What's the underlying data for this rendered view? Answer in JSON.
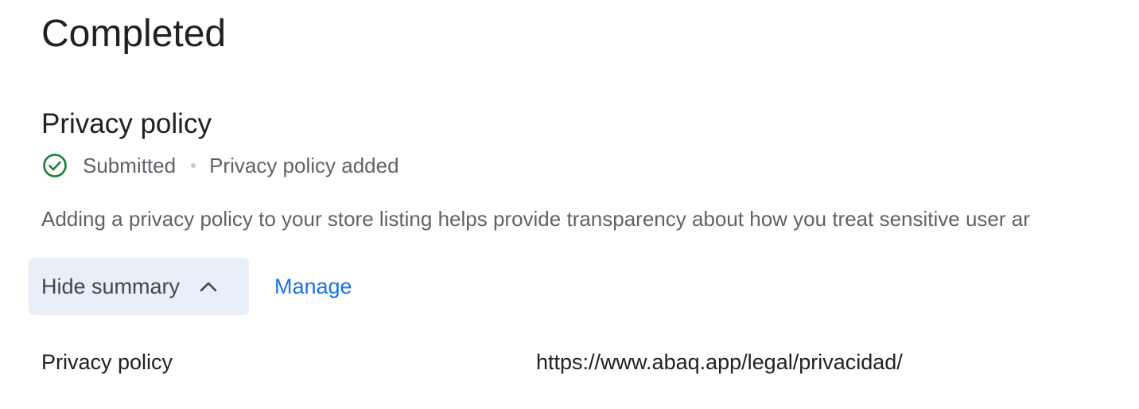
{
  "page": {
    "title": "Completed"
  },
  "section": {
    "title": "Privacy policy",
    "status_icon": "check-circle-icon",
    "status_color": "#188038",
    "status_label": "Submitted",
    "status_detail": "Privacy policy added",
    "description": "Adding a privacy policy to your store listing helps provide transparency about how you treat sensitive user ar"
  },
  "actions": {
    "hide_summary_label": "Hide summary",
    "hide_summary_icon": "chevron-up-icon",
    "manage_label": "Manage"
  },
  "summary": {
    "rows": [
      {
        "label": "Privacy policy",
        "value": "https://www.abaq.app/legal/privacidad/"
      }
    ]
  }
}
